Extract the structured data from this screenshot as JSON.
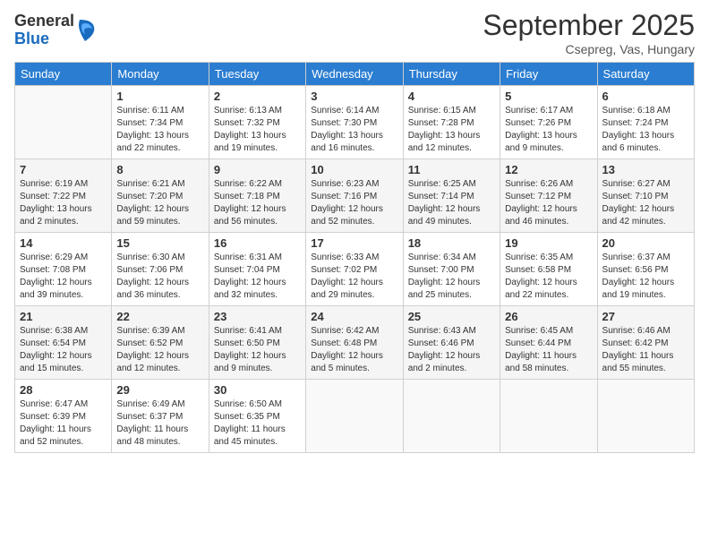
{
  "header": {
    "logo": {
      "general": "General",
      "blue": "Blue"
    },
    "title": "September 2025",
    "location": "Csepreg, Vas, Hungary"
  },
  "weekdays": [
    "Sunday",
    "Monday",
    "Tuesday",
    "Wednesday",
    "Thursday",
    "Friday",
    "Saturday"
  ],
  "weeks": [
    [
      {
        "day": "",
        "sunrise": "",
        "sunset": "",
        "daylight": ""
      },
      {
        "day": "1",
        "sunrise": "Sunrise: 6:11 AM",
        "sunset": "Sunset: 7:34 PM",
        "daylight": "Daylight: 13 hours and 22 minutes."
      },
      {
        "day": "2",
        "sunrise": "Sunrise: 6:13 AM",
        "sunset": "Sunset: 7:32 PM",
        "daylight": "Daylight: 13 hours and 19 minutes."
      },
      {
        "day": "3",
        "sunrise": "Sunrise: 6:14 AM",
        "sunset": "Sunset: 7:30 PM",
        "daylight": "Daylight: 13 hours and 16 minutes."
      },
      {
        "day": "4",
        "sunrise": "Sunrise: 6:15 AM",
        "sunset": "Sunset: 7:28 PM",
        "daylight": "Daylight: 13 hours and 12 minutes."
      },
      {
        "day": "5",
        "sunrise": "Sunrise: 6:17 AM",
        "sunset": "Sunset: 7:26 PM",
        "daylight": "Daylight: 13 hours and 9 minutes."
      },
      {
        "day": "6",
        "sunrise": "Sunrise: 6:18 AM",
        "sunset": "Sunset: 7:24 PM",
        "daylight": "Daylight: 13 hours and 6 minutes."
      }
    ],
    [
      {
        "day": "7",
        "sunrise": "Sunrise: 6:19 AM",
        "sunset": "Sunset: 7:22 PM",
        "daylight": "Daylight: 13 hours and 2 minutes."
      },
      {
        "day": "8",
        "sunrise": "Sunrise: 6:21 AM",
        "sunset": "Sunset: 7:20 PM",
        "daylight": "Daylight: 12 hours and 59 minutes."
      },
      {
        "day": "9",
        "sunrise": "Sunrise: 6:22 AM",
        "sunset": "Sunset: 7:18 PM",
        "daylight": "Daylight: 12 hours and 56 minutes."
      },
      {
        "day": "10",
        "sunrise": "Sunrise: 6:23 AM",
        "sunset": "Sunset: 7:16 PM",
        "daylight": "Daylight: 12 hours and 52 minutes."
      },
      {
        "day": "11",
        "sunrise": "Sunrise: 6:25 AM",
        "sunset": "Sunset: 7:14 PM",
        "daylight": "Daylight: 12 hours and 49 minutes."
      },
      {
        "day": "12",
        "sunrise": "Sunrise: 6:26 AM",
        "sunset": "Sunset: 7:12 PM",
        "daylight": "Daylight: 12 hours and 46 minutes."
      },
      {
        "day": "13",
        "sunrise": "Sunrise: 6:27 AM",
        "sunset": "Sunset: 7:10 PM",
        "daylight": "Daylight: 12 hours and 42 minutes."
      }
    ],
    [
      {
        "day": "14",
        "sunrise": "Sunrise: 6:29 AM",
        "sunset": "Sunset: 7:08 PM",
        "daylight": "Daylight: 12 hours and 39 minutes."
      },
      {
        "day": "15",
        "sunrise": "Sunrise: 6:30 AM",
        "sunset": "Sunset: 7:06 PM",
        "daylight": "Daylight: 12 hours and 36 minutes."
      },
      {
        "day": "16",
        "sunrise": "Sunrise: 6:31 AM",
        "sunset": "Sunset: 7:04 PM",
        "daylight": "Daylight: 12 hours and 32 minutes."
      },
      {
        "day": "17",
        "sunrise": "Sunrise: 6:33 AM",
        "sunset": "Sunset: 7:02 PM",
        "daylight": "Daylight: 12 hours and 29 minutes."
      },
      {
        "day": "18",
        "sunrise": "Sunrise: 6:34 AM",
        "sunset": "Sunset: 7:00 PM",
        "daylight": "Daylight: 12 hours and 25 minutes."
      },
      {
        "day": "19",
        "sunrise": "Sunrise: 6:35 AM",
        "sunset": "Sunset: 6:58 PM",
        "daylight": "Daylight: 12 hours and 22 minutes."
      },
      {
        "day": "20",
        "sunrise": "Sunrise: 6:37 AM",
        "sunset": "Sunset: 6:56 PM",
        "daylight": "Daylight: 12 hours and 19 minutes."
      }
    ],
    [
      {
        "day": "21",
        "sunrise": "Sunrise: 6:38 AM",
        "sunset": "Sunset: 6:54 PM",
        "daylight": "Daylight: 12 hours and 15 minutes."
      },
      {
        "day": "22",
        "sunrise": "Sunrise: 6:39 AM",
        "sunset": "Sunset: 6:52 PM",
        "daylight": "Daylight: 12 hours and 12 minutes."
      },
      {
        "day": "23",
        "sunrise": "Sunrise: 6:41 AM",
        "sunset": "Sunset: 6:50 PM",
        "daylight": "Daylight: 12 hours and 9 minutes."
      },
      {
        "day": "24",
        "sunrise": "Sunrise: 6:42 AM",
        "sunset": "Sunset: 6:48 PM",
        "daylight": "Daylight: 12 hours and 5 minutes."
      },
      {
        "day": "25",
        "sunrise": "Sunrise: 6:43 AM",
        "sunset": "Sunset: 6:46 PM",
        "daylight": "Daylight: 12 hours and 2 minutes."
      },
      {
        "day": "26",
        "sunrise": "Sunrise: 6:45 AM",
        "sunset": "Sunset: 6:44 PM",
        "daylight": "Daylight: 11 hours and 58 minutes."
      },
      {
        "day": "27",
        "sunrise": "Sunrise: 6:46 AM",
        "sunset": "Sunset: 6:42 PM",
        "daylight": "Daylight: 11 hours and 55 minutes."
      }
    ],
    [
      {
        "day": "28",
        "sunrise": "Sunrise: 6:47 AM",
        "sunset": "Sunset: 6:39 PM",
        "daylight": "Daylight: 11 hours and 52 minutes."
      },
      {
        "day": "29",
        "sunrise": "Sunrise: 6:49 AM",
        "sunset": "Sunset: 6:37 PM",
        "daylight": "Daylight: 11 hours and 48 minutes."
      },
      {
        "day": "30",
        "sunrise": "Sunrise: 6:50 AM",
        "sunset": "Sunset: 6:35 PM",
        "daylight": "Daylight: 11 hours and 45 minutes."
      },
      {
        "day": "",
        "sunrise": "",
        "sunset": "",
        "daylight": ""
      },
      {
        "day": "",
        "sunrise": "",
        "sunset": "",
        "daylight": ""
      },
      {
        "day": "",
        "sunrise": "",
        "sunset": "",
        "daylight": ""
      },
      {
        "day": "",
        "sunrise": "",
        "sunset": "",
        "daylight": ""
      }
    ]
  ]
}
